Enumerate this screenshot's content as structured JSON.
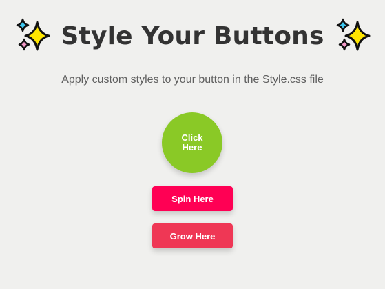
{
  "header": {
    "title": "Style Your Buttons",
    "icon": "sparkles-icon",
    "subtitle": "Apply custom styles to your button in the Style.css file"
  },
  "buttons": {
    "click": {
      "label": "Click Here",
      "color": "#8ac926"
    },
    "spin": {
      "label": "Spin Here",
      "color": "#ff0054"
    },
    "grow": {
      "label": "Grow Here",
      "color": "#ef3755"
    }
  },
  "colors": {
    "background": "#f0f0ee",
    "title_text": "#333333",
    "subtitle_text": "#5f5f5f",
    "sparkle_main": "#ffe600",
    "sparkle_blue": "#3fc8f0",
    "sparkle_pink": "#f59bc9"
  }
}
